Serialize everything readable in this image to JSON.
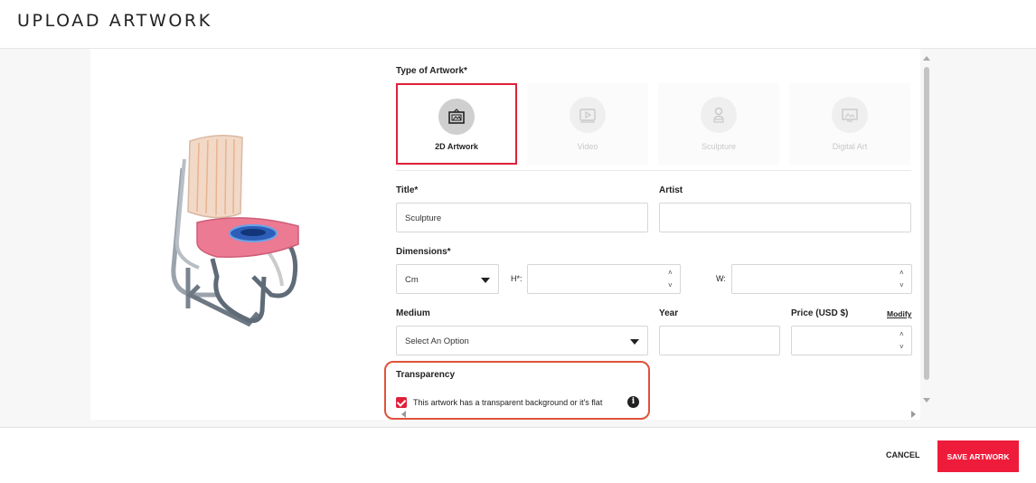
{
  "header": {
    "title": "UPLOAD ARTWORK"
  },
  "form": {
    "type_label": "Type of Artwork*",
    "types": [
      {
        "label": "2D Artwork",
        "icon": "picture-frame-icon",
        "selected": true
      },
      {
        "label": "Video",
        "icon": "video-play-icon",
        "selected": false
      },
      {
        "label": "Sculpture",
        "icon": "sculpture-bust-icon",
        "selected": false
      },
      {
        "label": "Digital Art",
        "icon": "digital-art-icon",
        "selected": false
      }
    ],
    "title_label": "Title*",
    "title_value": "Sculpture",
    "artist_label": "Artist",
    "artist_value": "",
    "dimensions_label": "Dimensions*",
    "unit_value": "Cm",
    "height_label": "H*:",
    "width_label": "W:",
    "medium_label": "Medium",
    "medium_value": "Select An Option",
    "year_label": "Year",
    "price_label": "Price (USD $)",
    "modify_label": "Modify",
    "transparency_label": "Transparency",
    "transparency_checked": true,
    "transparency_text": "This artwork has a transparent background or it's flat"
  },
  "footer": {
    "cancel_label": "CANCEL",
    "save_label": "SAVE ARTWORK"
  },
  "colors": {
    "accent": "#ee1c3a",
    "highlight": "#e0523a"
  }
}
